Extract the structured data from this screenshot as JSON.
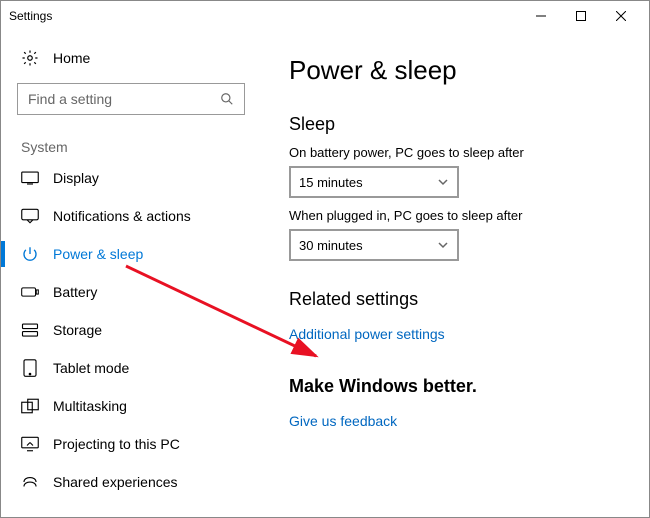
{
  "window": {
    "title": "Settings"
  },
  "home": {
    "label": "Home"
  },
  "search": {
    "placeholder": "Find a setting"
  },
  "group": {
    "label": "System"
  },
  "nav": {
    "display": "Display",
    "notifications": "Notifications & actions",
    "power": "Power & sleep",
    "battery": "Battery",
    "storage": "Storage",
    "tablet": "Tablet mode",
    "multitasking": "Multitasking",
    "projecting": "Projecting to this PC",
    "shared": "Shared experiences"
  },
  "main": {
    "title": "Power & sleep",
    "sleep_heading": "Sleep",
    "battery_label": "On battery power, PC goes to sleep after",
    "battery_value": "15 minutes",
    "plugged_label": "When plugged in, PC goes to sleep after",
    "plugged_value": "30 minutes",
    "related_heading": "Related settings",
    "related_link": "Additional power settings",
    "better_heading": "Make Windows better.",
    "feedback_link": "Give us feedback"
  }
}
